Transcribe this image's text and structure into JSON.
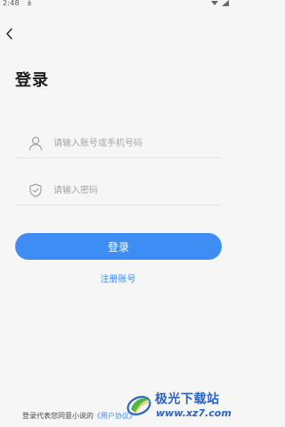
{
  "status_bar": {
    "time": "2:48",
    "download_icon": "download-arrow-icon",
    "right_icons": [
      "wifi-icon",
      "signal-icon"
    ]
  },
  "nav": {
    "back_icon": "chevron-left-icon"
  },
  "page": {
    "title": "登录"
  },
  "form": {
    "account": {
      "icon": "user-icon",
      "placeholder": "请输入账号或手机号码",
      "value": ""
    },
    "password": {
      "icon": "shield-icon",
      "placeholder": "请输入密码",
      "value": ""
    },
    "login_label": "登录",
    "register_label": "注册账号"
  },
  "footer": {
    "agreement_prefix": "登录代表您同意小说的",
    "agreement_link": "《用户协议》"
  },
  "watermark": {
    "name": "极光下载站",
    "url": "www.xz7.com"
  },
  "colors": {
    "background": "#f6f6f6",
    "accent": "#3d8df5",
    "watermark": "#2a62c4"
  }
}
